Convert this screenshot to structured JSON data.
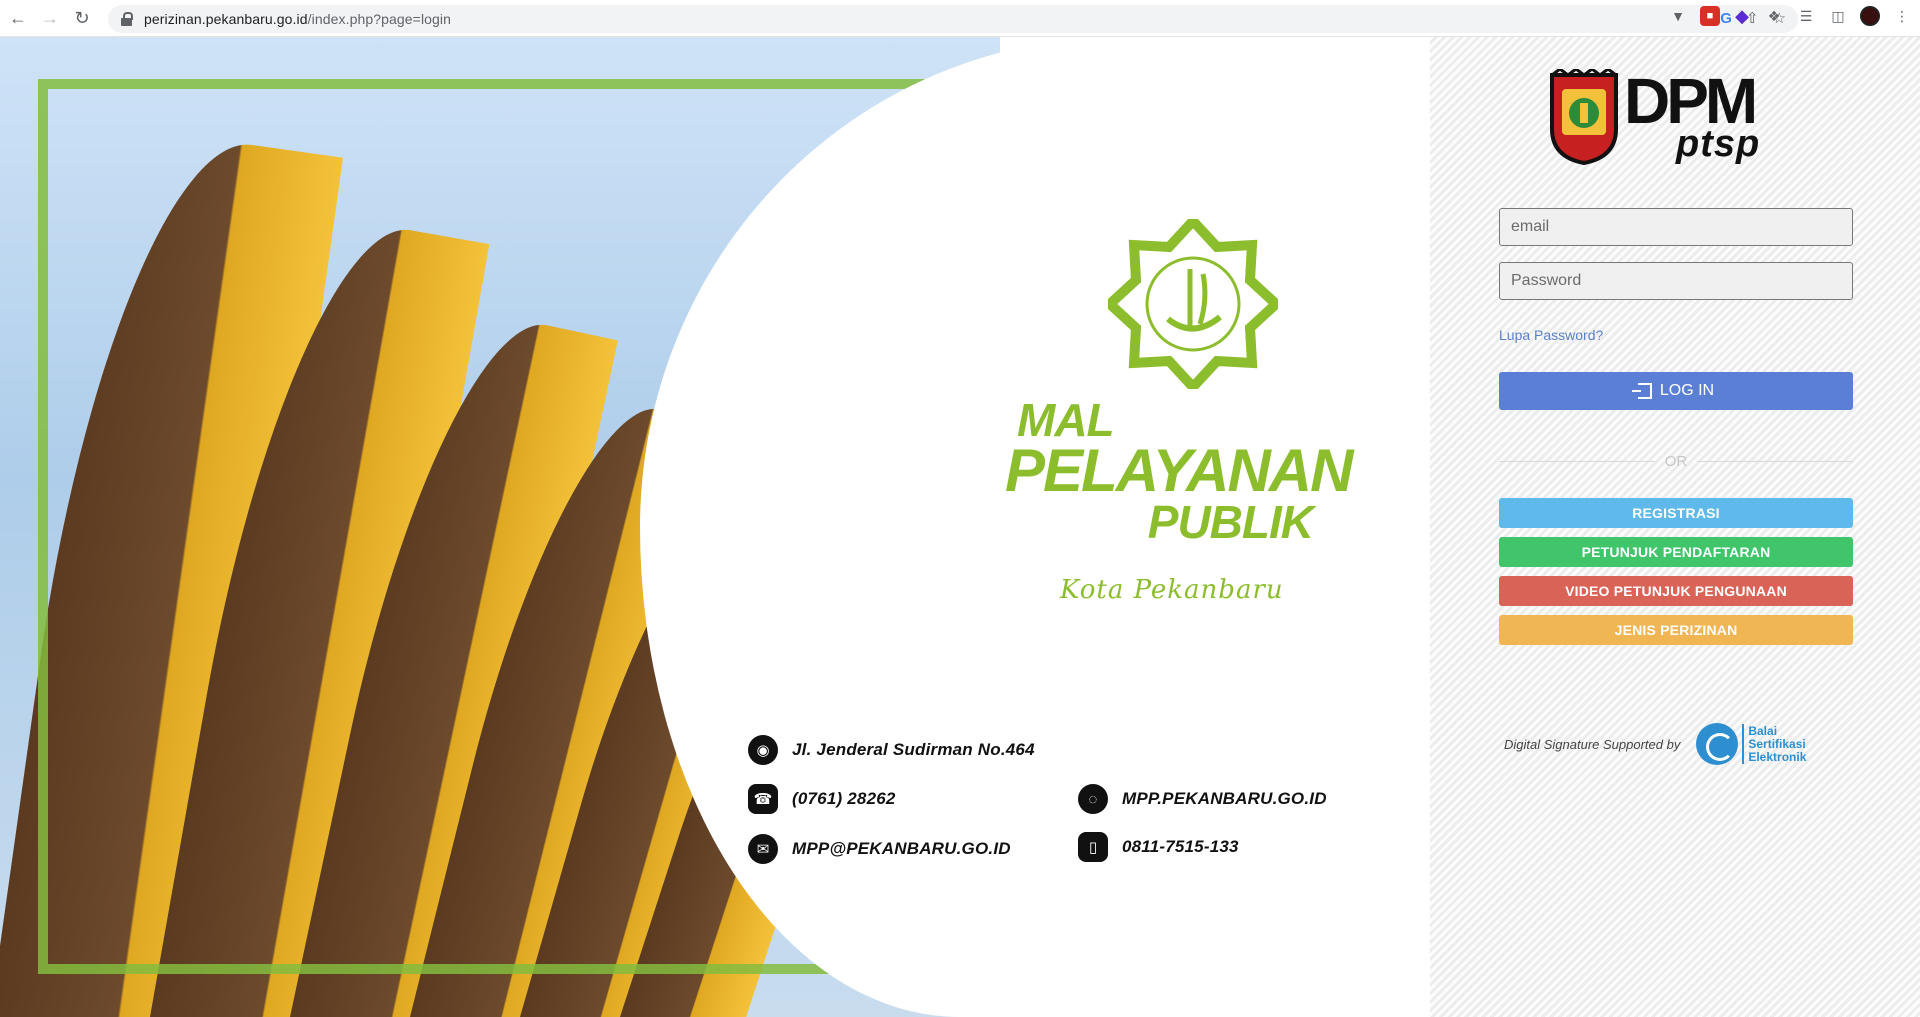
{
  "browser": {
    "url_host": "perizinan.pekanbaru.go.id",
    "url_path": "/index.php?page=login"
  },
  "logo": {
    "mpp_line1": "MAL",
    "mpp_line2": "PELAYANAN",
    "mpp_line3": "PUBLIK",
    "mpp_sub": "Kota Pekanbaru",
    "dpm": "DPM",
    "ptsp": "ptsp"
  },
  "contact": {
    "address": "Jl. Jenderal Sudirman No.464",
    "phone": "(0761) 28262",
    "email": "MPP@PEKANBARU.GO.ID",
    "website": "MPP.PEKANBARU.GO.ID",
    "mobile": "0811-7515-133"
  },
  "login": {
    "email_placeholder": "email",
    "password_placeholder": "Password",
    "forgot": "Lupa Password?",
    "login_label": "LOG IN",
    "or_label": "OR",
    "registrasi": "REGISTRASI",
    "petunjuk": "PETUNJUK PENDAFTARAN",
    "video": "VIDEO PETUNJUK PENGUNAAN",
    "jenis": "JENIS PERIZINAN"
  },
  "footer": {
    "digital_signature": "Digital Signature Supported by",
    "bsre_line1": "Balai",
    "bsre_line2": "Sertifikasi",
    "bsre_line3": "Elektronik"
  },
  "colors": {
    "brand_green": "#8cbd2c",
    "login_blue": "#5b7fd4",
    "registrasi": "#5fb9ea",
    "petunjuk": "#41c56b",
    "video": "#d96356",
    "jenis": "#f0b653"
  }
}
